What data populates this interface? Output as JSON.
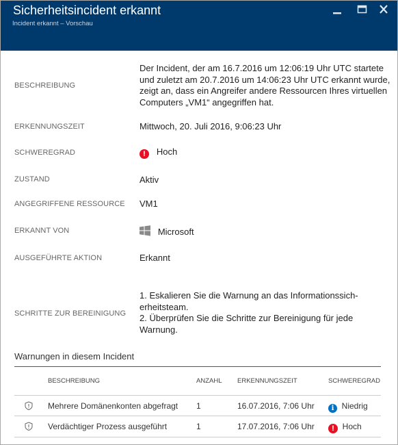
{
  "header": {
    "title": "Sicherheitsincident erkannt",
    "subtitle": "Incident erkannt – Vorschau",
    "minimize": "minimize",
    "maximize": "maximize",
    "close": "close"
  },
  "details": [
    {
      "label": "Beschreibung",
      "value": "Der Incident, der am 16.7.2016 um 12:06:19 Uhr UTC startete und zuletzt am 20.7.2016 um 14:06:23 Uhr UTC erkannt wurde, zeigt an, dass ein Angreifer andere Ressourcen Ihres virtuellen Computers „VM1“ angegriffen hat."
    },
    {
      "label": "Erkennungszeit",
      "value": "Mittwoch, 20. Juli 2016, 9:06:23 Uhr"
    },
    {
      "label": "Schweregrad",
      "value": "Hoch"
    },
    {
      "label": "Zustand",
      "value": "Aktiv"
    },
    {
      "label": "Angegriffene Ressource",
      "value": "VM1"
    },
    {
      "label": "Erkannt von",
      "value": "Microsoft"
    },
    {
      "label": "Ausgeführte Aktion",
      "value": "Erkannt"
    },
    {
      "label": "Schritte zur Bereinigung",
      "steps": [
        "1. Eskalieren Sie die Warnung an das Informationssich-erheitsteam.",
        "2. Überprüfen Sie die Schritte zur Bereinigung für jede Warnung."
      ]
    }
  ],
  "alerts": {
    "title": "Warnungen in diesem Incident",
    "columns": [
      "Beschreibung",
      "Anzahl",
      "Erkennungszeit",
      "Schweregrad"
    ],
    "rows": [
      {
        "description": "Mehrere Domänenkonten abgefragt",
        "count": "1",
        "time": "16.07.2016, 7:06 Uhr",
        "severity": "Niedrig"
      },
      {
        "description": "Verdächtiger Prozess ausgeführt",
        "count": "1",
        "time": "17.07.2016, 7:06 Uhr",
        "severity": "Hoch"
      }
    ]
  },
  "colors": {
    "header": "#003a6c",
    "high": "#e81123",
    "low": "#0072c6"
  }
}
